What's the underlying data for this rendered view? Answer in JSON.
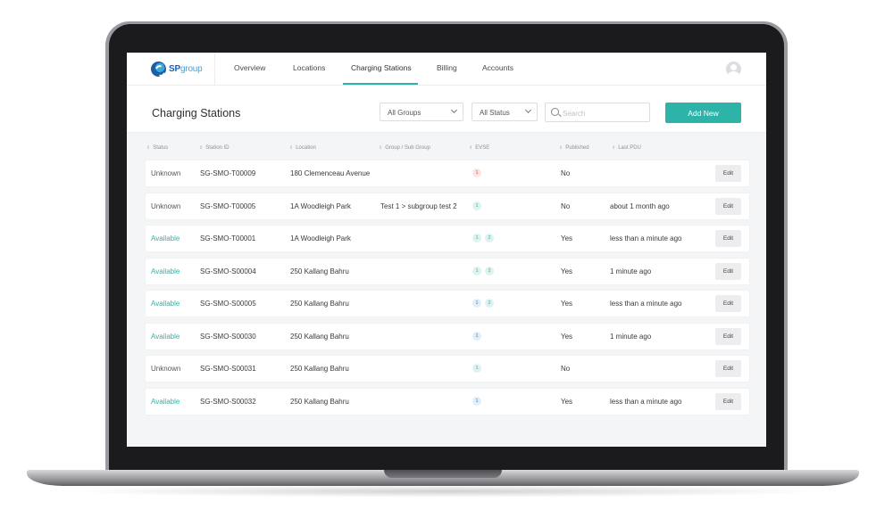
{
  "brand": {
    "logo_text_bold": "SP",
    "logo_text_light": "group"
  },
  "nav": {
    "items": [
      {
        "label": "Overview"
      },
      {
        "label": "Locations"
      },
      {
        "label": "Charging Stations",
        "active": true
      },
      {
        "label": "Billing"
      },
      {
        "label": "Accounts"
      }
    ]
  },
  "header": {
    "title": "Charging Stations",
    "group_filter": "All Groups",
    "status_filter": "All Status",
    "search_placeholder": "Search",
    "add_button": "Add New"
  },
  "table": {
    "columns": [
      "Status",
      "Station ID",
      "Location",
      "Group / Sub Group",
      "EVSE",
      "Published",
      "Last PDU"
    ],
    "edit_label": "Edit",
    "rows": [
      {
        "status": "Unknown",
        "station_id": "SG-SMO-T00009",
        "location": "180 Clemenceau Avenue",
        "group": "",
        "evse": [
          {
            "n": "1",
            "tone": "red"
          }
        ],
        "published": "No",
        "last_pdu": ""
      },
      {
        "status": "Unknown",
        "station_id": "SG-SMO-T00005",
        "location": "1A Woodleigh Park",
        "group": "Test 1 > subgroup test 2",
        "evse": [
          {
            "n": "1",
            "tone": "teal"
          }
        ],
        "published": "No",
        "last_pdu": "about 1 month ago"
      },
      {
        "status": "Available",
        "station_id": "SG-SMO-T00001",
        "location": "1A Woodleigh Park",
        "group": "",
        "evse": [
          {
            "n": "1",
            "tone": "teal"
          },
          {
            "n": "2",
            "tone": "teal"
          }
        ],
        "published": "Yes",
        "last_pdu": "less than a minute ago"
      },
      {
        "status": "Available",
        "station_id": "SG-SMO-S00004",
        "location": "250 Kallang Bahru",
        "group": "",
        "evse": [
          {
            "n": "1",
            "tone": "teal"
          },
          {
            "n": "2",
            "tone": "teal"
          }
        ],
        "published": "Yes",
        "last_pdu": "1 minute ago"
      },
      {
        "status": "Available",
        "station_id": "SG-SMO-S00005",
        "location": "250 Kallang Bahru",
        "group": "",
        "evse": [
          {
            "n": "1",
            "tone": "blue"
          },
          {
            "n": "2",
            "tone": "teal"
          }
        ],
        "published": "Yes",
        "last_pdu": "less than a minute ago"
      },
      {
        "status": "Available",
        "station_id": "SG-SMO-S00030",
        "location": "250 Kallang Bahru",
        "group": "",
        "evse": [
          {
            "n": "1",
            "tone": "blue"
          }
        ],
        "published": "Yes",
        "last_pdu": "1 minute ago"
      },
      {
        "status": "Unknown",
        "station_id": "SG-SMO-S00031",
        "location": "250 Kallang Bahru",
        "group": "",
        "evse": [
          {
            "n": "1",
            "tone": "teal"
          }
        ],
        "published": "No",
        "last_pdu": ""
      },
      {
        "status": "Available",
        "station_id": "SG-SMO-S00032",
        "location": "250 Kallang Bahru",
        "group": "",
        "evse": [
          {
            "n": "1",
            "tone": "blue"
          }
        ],
        "published": "Yes",
        "last_pdu": "less than a minute ago"
      }
    ]
  },
  "colors": {
    "accent": "#2db3a8",
    "available": "#2db3a8",
    "unknown": "#55565b"
  }
}
